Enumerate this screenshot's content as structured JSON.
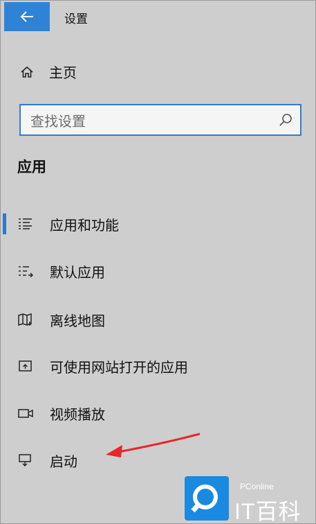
{
  "window": {
    "title": "设置"
  },
  "home": {
    "label": "主页"
  },
  "search": {
    "placeholder": "查找设置"
  },
  "section": {
    "title": "应用"
  },
  "nav": {
    "items": [
      {
        "label": "应用和功能",
        "icon": "apps-features-icon",
        "selected": true
      },
      {
        "label": "默认应用",
        "icon": "default-apps-icon",
        "selected": false
      },
      {
        "label": "离线地图",
        "icon": "offline-maps-icon",
        "selected": false
      },
      {
        "label": "可使用网站打开的应用",
        "icon": "apps-for-websites-icon",
        "selected": false
      },
      {
        "label": "视频播放",
        "icon": "video-playback-icon",
        "selected": false
      },
      {
        "label": "启动",
        "icon": "startup-icon",
        "selected": false
      }
    ]
  },
  "annotation": {
    "type": "red-arrow",
    "points_to": "启动",
    "color": "#e8262b"
  },
  "watermark": {
    "small": "PConline",
    "big": "IT百科",
    "color": "#1a8ae0"
  },
  "colors": {
    "accent": "#2f83d6",
    "background": "#cecece"
  }
}
